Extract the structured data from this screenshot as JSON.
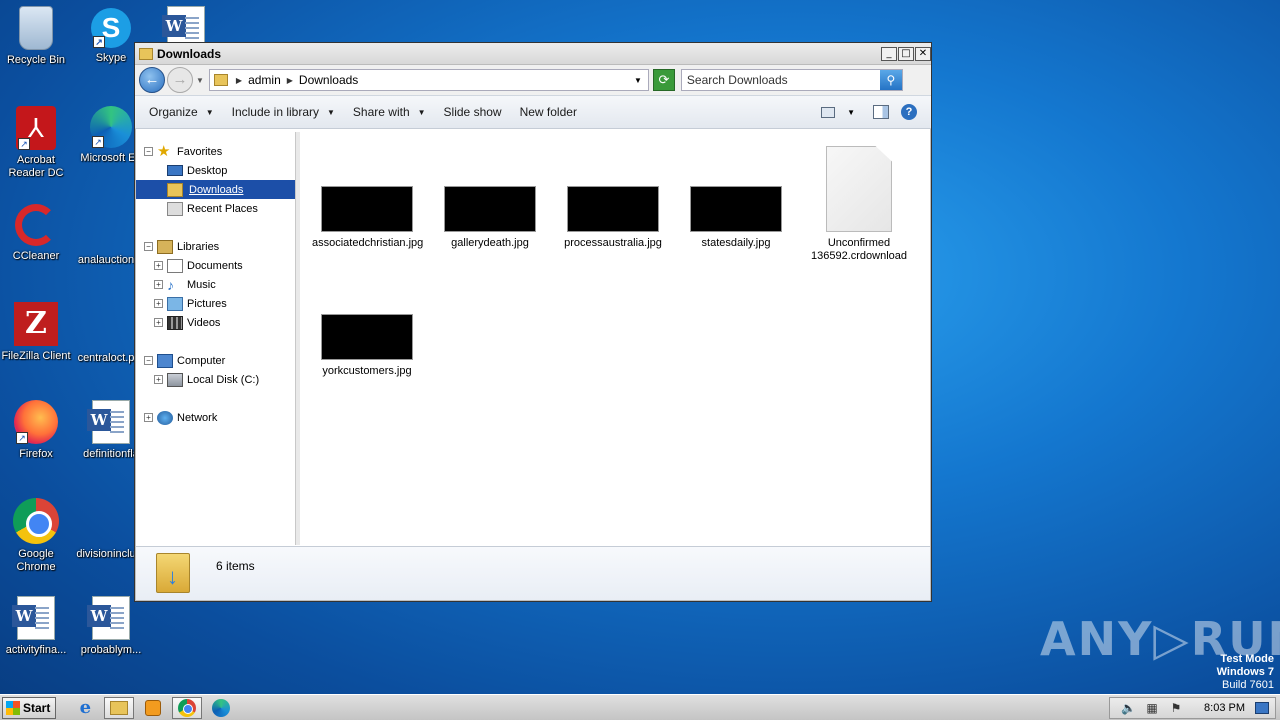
{
  "desktop": {
    "icons": [
      {
        "label": "Recycle Bin"
      },
      {
        "label": "Skype"
      },
      {
        "label": "Acrobat Reader DC"
      },
      {
        "label": "Microsoft Ed"
      },
      {
        "label": "CCleaner"
      },
      {
        "label": "analauction"
      },
      {
        "label": "FileZilla Client"
      },
      {
        "label": "centraloct.p"
      },
      {
        "label": "Firefox"
      },
      {
        "label": "definitionfla"
      },
      {
        "label": "Google Chrome"
      },
      {
        "label": "divisioninclu"
      },
      {
        "label": "activityfina..."
      },
      {
        "label": "probablym..."
      }
    ],
    "watermark": {
      "line1": "Test Mode",
      "line2": "Windows 7",
      "line3": "Build 7601"
    },
    "brand": "ANY▷RUN"
  },
  "window": {
    "title": "Downloads",
    "controls": {
      "minimize": "_",
      "maximize": "□",
      "close": "✕"
    },
    "nav": {
      "back": "←",
      "forward": "→"
    },
    "address": {
      "crumbs": [
        "admin",
        "Downloads"
      ]
    },
    "search": {
      "placeholder": "Search Downloads"
    },
    "toolbar": {
      "organize": "Organize",
      "include": "Include in library",
      "share": "Share with",
      "slideshow": "Slide show",
      "newfolder": "New folder"
    },
    "tree": {
      "favorites": "Favorites",
      "desktop": "Desktop",
      "downloads": "Downloads",
      "recent": "Recent Places",
      "libraries": "Libraries",
      "documents": "Documents",
      "music": "Music",
      "pictures": "Pictures",
      "videos": "Videos",
      "computer": "Computer",
      "localdisk": "Local Disk (C:)",
      "network": "Network"
    },
    "files": [
      {
        "name": "associatedchristian.jpg"
      },
      {
        "name": "gallerydeath.jpg"
      },
      {
        "name": "processaustralia.jpg"
      },
      {
        "name": "statesdaily.jpg"
      },
      {
        "name": "Unconfirmed 136592.crdownload"
      },
      {
        "name": "yorkcustomers.jpg"
      }
    ],
    "status": {
      "count": "6 items"
    }
  },
  "taskbar": {
    "start": "Start",
    "clock": "8:03 PM"
  }
}
